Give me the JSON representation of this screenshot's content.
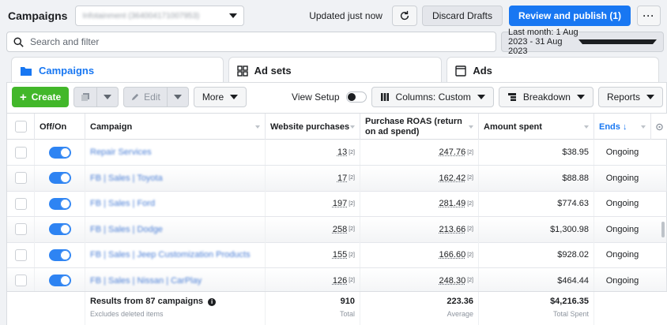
{
  "header": {
    "title": "Campaigns",
    "account": "Infotainment (364004171007953)",
    "updated": "Updated just now",
    "discard": "Discard Drafts",
    "review": "Review and publish (1)"
  },
  "search": {
    "placeholder": "Search and filter"
  },
  "date_range": "Last month: 1 Aug 2023 - 31 Aug 2023",
  "tabs": [
    {
      "label": "Campaigns"
    },
    {
      "label": "Ad sets"
    },
    {
      "label": "Ads"
    }
  ],
  "toolbar": {
    "create": "Create",
    "edit": "Edit",
    "more": "More",
    "view_setup": "View Setup",
    "columns": "Columns: Custom",
    "breakdown": "Breakdown",
    "reports": "Reports"
  },
  "columns": {
    "offon": "Off/On",
    "campaign": "Campaign",
    "purchases": "Website purchases",
    "roas": "Purchase ROAS (return on ad spend)",
    "spent": "Amount spent",
    "ends": "Ends ↓"
  },
  "rows": [
    {
      "campaign": "Repair Services",
      "purchases": "13",
      "roas": "247.76",
      "spent": "$38.95",
      "ends": "Ongoing"
    },
    {
      "campaign": "FB | Sales | Toyota",
      "purchases": "17",
      "roas": "162.42",
      "spent": "$88.88",
      "ends": "Ongoing"
    },
    {
      "campaign": "FB | Sales | Ford",
      "purchases": "197",
      "roas": "281.49",
      "spent": "$774.63",
      "ends": "Ongoing"
    },
    {
      "campaign": "FB | Sales | Dodge",
      "purchases": "258",
      "roas": "213.66",
      "spent": "$1,300.98",
      "ends": "Ongoing"
    },
    {
      "campaign": "FB | Sales | Jeep Customization Products",
      "purchases": "155",
      "roas": "166.60",
      "spent": "$928.02",
      "ends": "Ongoing"
    },
    {
      "campaign": "FB | Sales | Nissan | CarPlay",
      "purchases": "126",
      "roas": "248.30",
      "spent": "$464.44",
      "ends": "Ongoing"
    }
  ],
  "footnote_mark": "[2]",
  "footer": {
    "results": "Results from 87 campaigns",
    "excludes": "Excludes deleted items",
    "purchases_total": "910",
    "purchases_label": "Total",
    "roas_avg": "223.36",
    "roas_label": "Average",
    "spent_total": "$4,216.35",
    "spent_label": "Total Spent"
  },
  "colors": {
    "accent": "#1877f2",
    "create": "#42b72a"
  }
}
